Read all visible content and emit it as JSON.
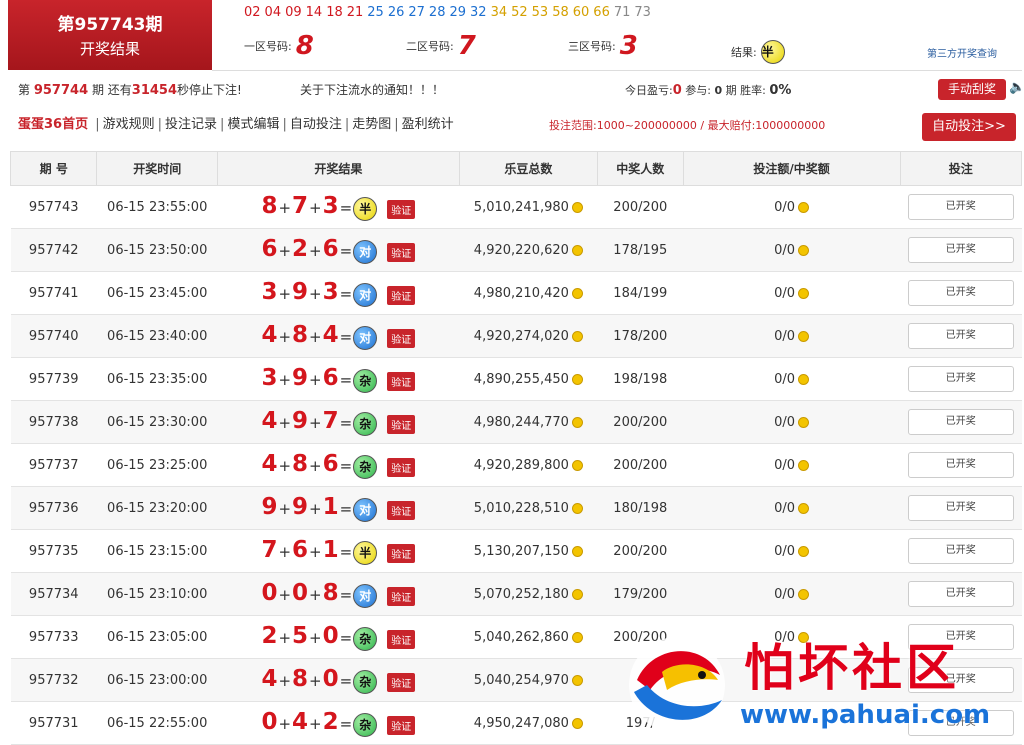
{
  "banner": {
    "issue": "第957743期",
    "subtitle": "开奖结果"
  },
  "number_strip": [
    {
      "n": "02",
      "c": "#d0171f"
    },
    {
      "n": "04",
      "c": "#d0171f"
    },
    {
      "n": "09",
      "c": "#d0171f"
    },
    {
      "n": "14",
      "c": "#d0171f"
    },
    {
      "n": "18",
      "c": "#d0171f"
    },
    {
      "n": "21",
      "c": "#d0171f"
    },
    {
      "n": "25",
      "c": "#1c6fd0"
    },
    {
      "n": "26",
      "c": "#1c6fd0"
    },
    {
      "n": "27",
      "c": "#1c6fd0"
    },
    {
      "n": "28",
      "c": "#1c6fd0"
    },
    {
      "n": "29",
      "c": "#1c6fd0"
    },
    {
      "n": "32",
      "c": "#1c6fd0"
    },
    {
      "n": "34",
      "c": "#d4a000"
    },
    {
      "n": "52",
      "c": "#d4a000"
    },
    {
      "n": "53",
      "c": "#d4a000"
    },
    {
      "n": "58",
      "c": "#d4a000"
    },
    {
      "n": "60",
      "c": "#d4a000"
    },
    {
      "n": "66",
      "c": "#d4a000"
    },
    {
      "n": "71",
      "c": "#888888"
    },
    {
      "n": "73",
      "c": "#888888"
    }
  ],
  "zones": {
    "zone1_label": "一区号码:",
    "zone1_value": "8",
    "zone2_label": "二区号码:",
    "zone2_value": "7",
    "zone3_label": "三区号码:",
    "zone3_value": "3",
    "result_label": "结果:",
    "result_value": "半"
  },
  "third_party_link": "第三方开奖查询",
  "info": {
    "prefix": "第",
    "next_issue": "957744",
    "mid1": "期 还有",
    "seconds": "31454",
    "mid2": "秒停止下注!",
    "notice": "关于下注流水的通知！！！",
    "today_label": "今日盈亏:",
    "today_value": "0",
    "join_label": "参与:",
    "join_value": "0",
    "join_unit": "期",
    "rate_label": "胜率:",
    "rate_value": "0%"
  },
  "buttons": {
    "manual": "手动刮奖",
    "auto": "自动投注>>"
  },
  "nav": {
    "home": "蛋蛋36首页",
    "items": [
      "游戏规则",
      "投注记录",
      "模式编辑",
      "自动投注",
      "走势图",
      "盈利统计"
    ]
  },
  "range_text": "投注范围:1000~200000000 / 最大赔付:1000000000",
  "table": {
    "headers": [
      "期 号",
      "开奖时间",
      "开奖结果",
      "乐豆总数",
      "中奖人数",
      "投注额/中奖额",
      "投注"
    ],
    "verify_label": "验证",
    "rows": [
      {
        "issue": "957743",
        "time": "06-15 23:55:00",
        "a": "8",
        "b": "7",
        "c": "3",
        "res": "半",
        "type": "ban",
        "total": "5,010,241,980",
        "winners": "200/200",
        "bet": "0/0",
        "status": "已开奖"
      },
      {
        "issue": "957742",
        "time": "06-15 23:50:00",
        "a": "6",
        "b": "2",
        "c": "6",
        "res": "对",
        "type": "dui",
        "total": "4,920,220,620",
        "winners": "178/195",
        "bet": "0/0",
        "status": "已开奖"
      },
      {
        "issue": "957741",
        "time": "06-15 23:45:00",
        "a": "3",
        "b": "9",
        "c": "3",
        "res": "对",
        "type": "dui",
        "total": "4,980,210,420",
        "winners": "184/199",
        "bet": "0/0",
        "status": "已开奖"
      },
      {
        "issue": "957740",
        "time": "06-15 23:40:00",
        "a": "4",
        "b": "8",
        "c": "4",
        "res": "对",
        "type": "dui",
        "total": "4,920,274,020",
        "winners": "178/200",
        "bet": "0/0",
        "status": "已开奖"
      },
      {
        "issue": "957739",
        "time": "06-15 23:35:00",
        "a": "3",
        "b": "9",
        "c": "6",
        "res": "杂",
        "type": "za",
        "total": "4,890,255,450",
        "winners": "198/198",
        "bet": "0/0",
        "status": "已开奖"
      },
      {
        "issue": "957738",
        "time": "06-15 23:30:00",
        "a": "4",
        "b": "9",
        "c": "7",
        "res": "杂",
        "type": "za",
        "total": "4,980,244,770",
        "winners": "200/200",
        "bet": "0/0",
        "status": "已开奖"
      },
      {
        "issue": "957737",
        "time": "06-15 23:25:00",
        "a": "4",
        "b": "8",
        "c": "6",
        "res": "杂",
        "type": "za",
        "total": "4,920,289,800",
        "winners": "200/200",
        "bet": "0/0",
        "status": "已开奖"
      },
      {
        "issue": "957736",
        "time": "06-15 23:20:00",
        "a": "9",
        "b": "9",
        "c": "1",
        "res": "对",
        "type": "dui",
        "total": "5,010,228,510",
        "winners": "180/198",
        "bet": "0/0",
        "status": "已开奖"
      },
      {
        "issue": "957735",
        "time": "06-15 23:15:00",
        "a": "7",
        "b": "6",
        "c": "1",
        "res": "半",
        "type": "ban",
        "total": "5,130,207,150",
        "winners": "200/200",
        "bet": "0/0",
        "status": "已开奖"
      },
      {
        "issue": "957734",
        "time": "06-15 23:10:00",
        "a": "0",
        "b": "0",
        "c": "8",
        "res": "对",
        "type": "dui",
        "total": "5,070,252,180",
        "winners": "179/200",
        "bet": "0/0",
        "status": "已开奖"
      },
      {
        "issue": "957733",
        "time": "06-15 23:05:00",
        "a": "2",
        "b": "5",
        "c": "0",
        "res": "杂",
        "type": "za",
        "total": "5,040,262,860",
        "winners": "200/200",
        "bet": "0/0",
        "status": "已开奖"
      },
      {
        "issue": "957732",
        "time": "06-15 23:00:00",
        "a": "4",
        "b": "8",
        "c": "0",
        "res": "杂",
        "type": "za",
        "total": "5,040,254,970",
        "winners": "",
        "bet": "",
        "status": "已开奖"
      },
      {
        "issue": "957731",
        "time": "06-15 22:55:00",
        "a": "0",
        "b": "4",
        "c": "2",
        "res": "杂",
        "type": "za",
        "total": "4,950,247,080",
        "winners": "197/",
        "bet": "",
        "status": "已开奖"
      }
    ]
  },
  "watermark": {
    "cn": "怕坏社区",
    "url": "www.pahuai.com"
  }
}
